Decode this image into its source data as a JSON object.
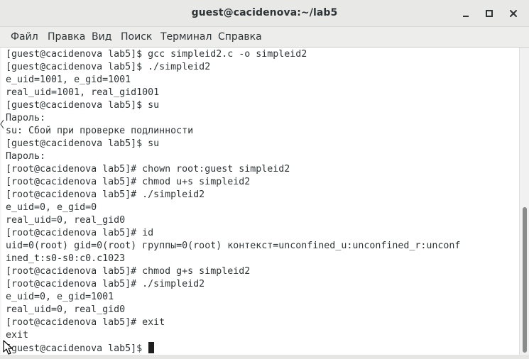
{
  "window": {
    "title": "guest@cacidenova:~/lab5"
  },
  "menu": {
    "items": [
      "Файл",
      "Правка",
      "Вид",
      "Поиск",
      "Терминал",
      "Справка"
    ]
  },
  "terminal": {
    "lines": [
      "[guest@cacidenova lab5]$ gcc simpleid2.c -o simpleid2",
      "[guest@cacidenova lab5]$ ./simpleid2",
      "e_uid=1001, e_gid=1001",
      "real_uid=1001, real_gid1001",
      "[guest@cacidenova lab5]$ su",
      "Пароль:",
      "su: Сбой при проверке подлинности",
      "[guest@cacidenova lab5]$ su",
      "Пароль:",
      "[root@cacidenova lab5]# chown root:guest simpleid2",
      "[root@cacidenova lab5]# chmod u+s simpleid2",
      "[root@cacidenova lab5]# ./simpleid2",
      "e_uid=0, e_gid=0",
      "real_uid=0, real_gid0",
      "[root@cacidenova lab5]# id",
      "uid=0(root) gid=0(root) группы=0(root) контекст=unconfined_u:unconfined_r:unconf",
      "ined_t:s0-s0:c0.c1023",
      "[root@cacidenova lab5]# chmod g+s simpleid2",
      "[root@cacidenova lab5]# ./simpleid2",
      "e_uid=0, e_gid=1001",
      "real_uid=0, real_gid0",
      "[root@cacidenova lab5]# exit",
      "exit"
    ],
    "prompt": "[guest@cacidenova lab5]$ "
  },
  "icons": {
    "minimize": "minimize-icon",
    "maximize": "maximize-icon",
    "close": "close-icon",
    "pointer": "mouse-pointer-icon"
  },
  "colors": {
    "titlebar": "#e8e8e7",
    "menubar": "#ededec",
    "terminal_bg": "#ffffff",
    "terminal_fg": "#2e3436",
    "scroll_thumb": "#8a8c8c"
  }
}
